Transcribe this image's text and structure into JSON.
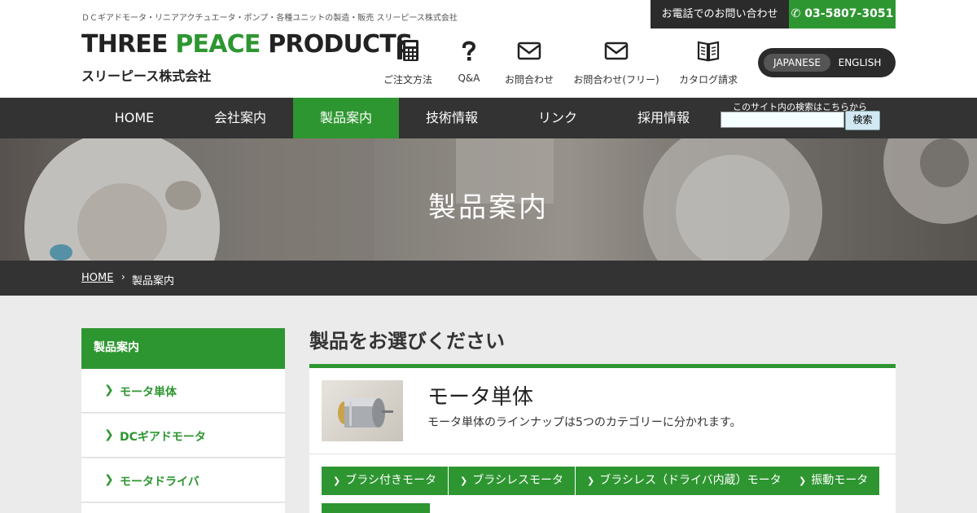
{
  "header": {
    "tagline": "ＤＣギアドモータ・リニアアクチュエータ・ポンプ・各種ユニットの製造・販売 スリーピース株式会社",
    "logo_word1": "THREE",
    "logo_word2": "PEACE",
    "logo_word3": "PRODUCTS",
    "logo_jp": "スリーピース株式会社",
    "contact_label": "お電話でのお問い合わせ",
    "phone": "03-5807-3051",
    "icons": [
      {
        "label": "ご注文方法",
        "icon": "calculator-icon"
      },
      {
        "label": "Q&A",
        "icon": "question-icon"
      },
      {
        "label": "お問合わせ",
        "icon": "envelope-icon"
      },
      {
        "label": "お問合わせ(フリー)",
        "icon": "envelope-icon"
      },
      {
        "label": "カタログ請求",
        "icon": "book-icon"
      }
    ],
    "lang": {
      "active": "JAPANESE",
      "other": "ENGLISH"
    }
  },
  "nav": {
    "items": [
      "HOME",
      "会社案内",
      "製品案内",
      "技術情報",
      "リンク",
      "採用情報"
    ],
    "active_index": 2,
    "search_caption": "このサイト内の検索はこちらから",
    "search_value": "",
    "search_button": "検索"
  },
  "hero": {
    "title": "製品案内"
  },
  "breadcrumb": {
    "home": "HOME",
    "current": "製品案内"
  },
  "sidebar": {
    "heading": "製品案内",
    "items": [
      "モータ単体",
      "DCギアドモータ",
      "モータドライバ"
    ]
  },
  "main": {
    "title": "製品をお選びください",
    "card": {
      "title": "モータ単体",
      "desc": "モータ単体のラインナップは5つのカテゴリーに分かれます。",
      "buttons": [
        "ブラシ付きモータ",
        "ブラシレスモータ",
        "ブラシレス（ドライバ内蔵）モータ",
        "振動モータ"
      ]
    }
  },
  "colors": {
    "accent": "#2e9631",
    "dark": "#333333",
    "background": "#ebebeb"
  }
}
